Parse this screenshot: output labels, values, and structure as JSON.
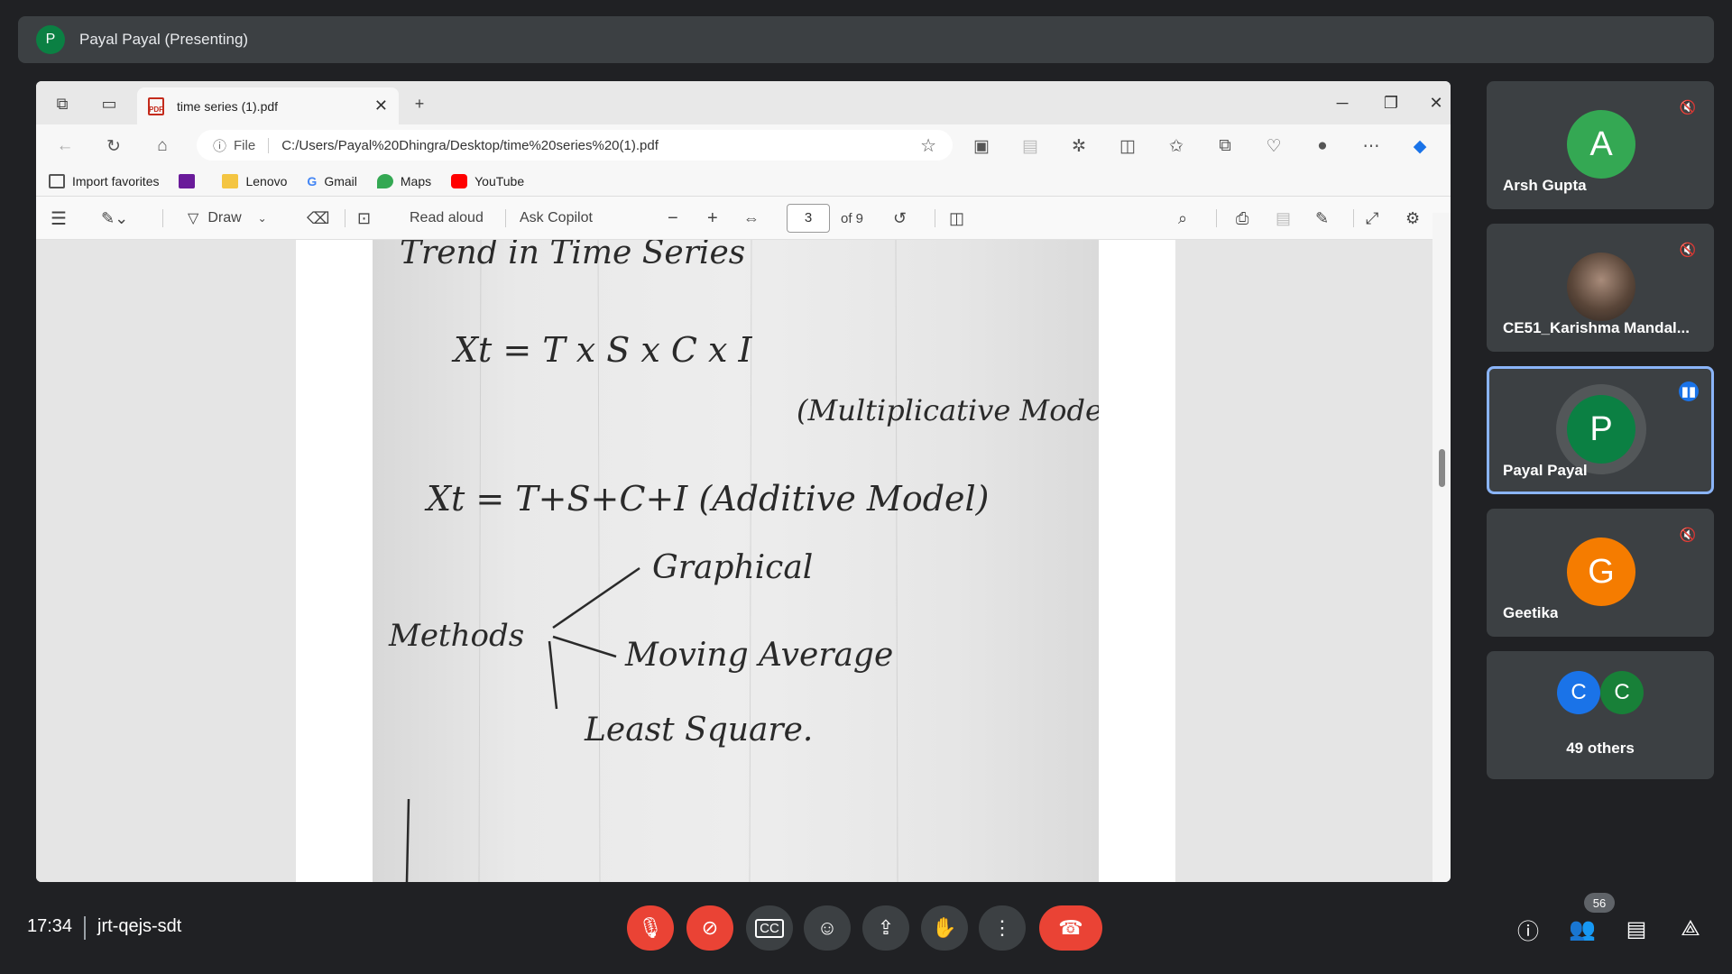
{
  "presenter": {
    "initial": "P",
    "label": "Payal Payal (Presenting)"
  },
  "browser": {
    "tab_title": "time series (1).pdf",
    "address": {
      "prefix": "File",
      "url": "C:/Users/Payal%20Dhingra/Desktop/time%20series%20(1).pdf"
    },
    "bookmarks": [
      "Import favorites",
      "Lenovo",
      "Gmail",
      "Maps",
      "YouTube"
    ],
    "pdf_toolbar": {
      "draw": "Draw",
      "read_aloud": "Read aloud",
      "ask_copilot": "Ask Copilot",
      "page": "3",
      "of_pages": "of 9"
    }
  },
  "document": {
    "heading": "Trend in Time Series",
    "eq1": "Xt = T x S x C x I",
    "eq1_note": "(Multiplicative Model)",
    "eq2": "Xt = T+S+C+I (Additive Model)",
    "methods_label": "Methods",
    "methods": [
      "Graphical",
      "Moving Average",
      "Least Square."
    ]
  },
  "participants": [
    {
      "initial": "A",
      "name": "Arsh Gupta",
      "color": "#34a853",
      "muted": true
    },
    {
      "initial": "",
      "name": "CE51_Karishma Mandal...",
      "color": "#6b5b4f",
      "muted": true
    },
    {
      "initial": "P",
      "name": "Payal Payal",
      "color": "#0b8043",
      "muted": false
    },
    {
      "initial": "G",
      "name": "Geetika",
      "color": "#f57c00",
      "muted": true
    }
  ],
  "others": {
    "initials": [
      "C",
      "C"
    ],
    "colors": [
      "#1a73e8",
      "#188038"
    ],
    "label": "49 others"
  },
  "bottom": {
    "time": "17:34",
    "code": "jrt-qejs-sdt",
    "people_count": "56"
  }
}
